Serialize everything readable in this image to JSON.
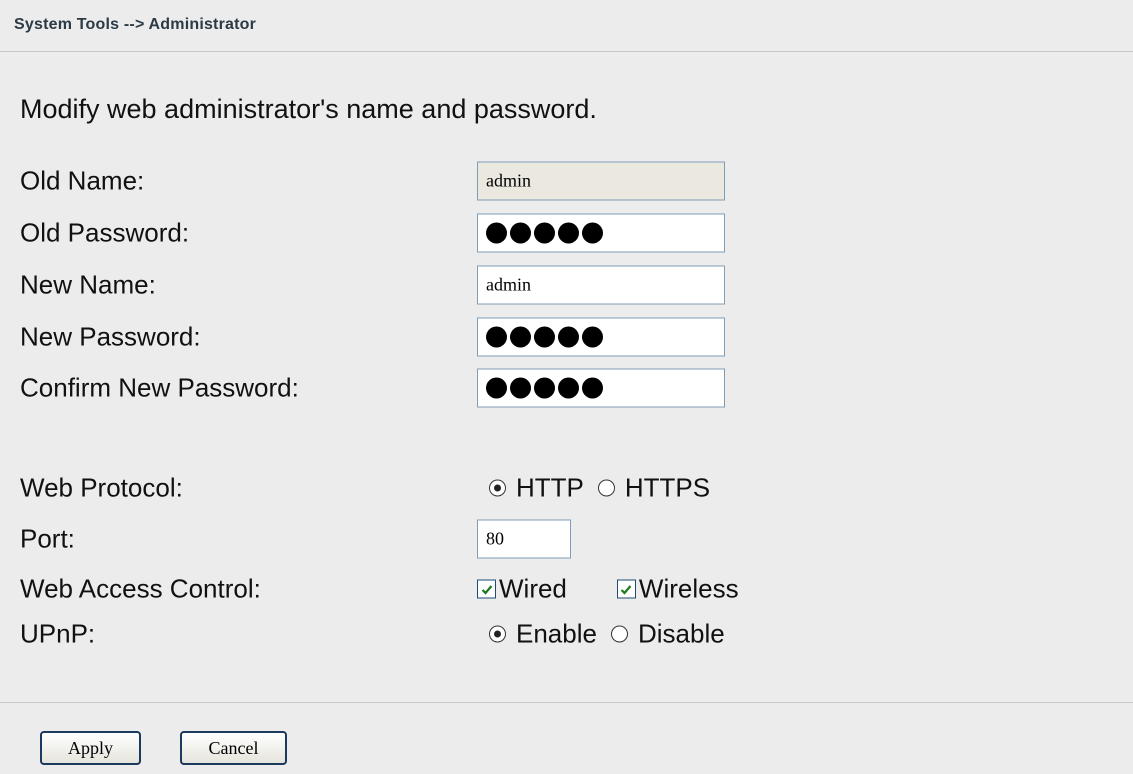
{
  "breadcrumb": "System Tools --> Administrator",
  "description": "Modify web administrator's name and password.",
  "fields": {
    "old_name": {
      "label": "Old Name:",
      "value": "admin"
    },
    "old_password": {
      "label": "Old Password:",
      "masked_length": 5
    },
    "new_name": {
      "label": "New Name:",
      "value": "admin"
    },
    "new_password": {
      "label": "New Password:",
      "masked_length": 5
    },
    "confirm_password": {
      "label": "Confirm New Password:",
      "masked_length": 5
    }
  },
  "web_protocol": {
    "label": "Web Protocol:",
    "options": [
      "HTTP",
      "HTTPS"
    ],
    "selected": "HTTP"
  },
  "port": {
    "label": "Port:",
    "value": "80"
  },
  "web_access_control": {
    "label": "Web Access Control:",
    "wired_label": "Wired",
    "wired_checked": true,
    "wireless_label": "Wireless",
    "wireless_checked": true
  },
  "upnp": {
    "label": "UPnP:",
    "options": [
      "Enable",
      "Disable"
    ],
    "selected": "Enable"
  },
  "buttons": {
    "apply": "Apply",
    "cancel": "Cancel"
  }
}
